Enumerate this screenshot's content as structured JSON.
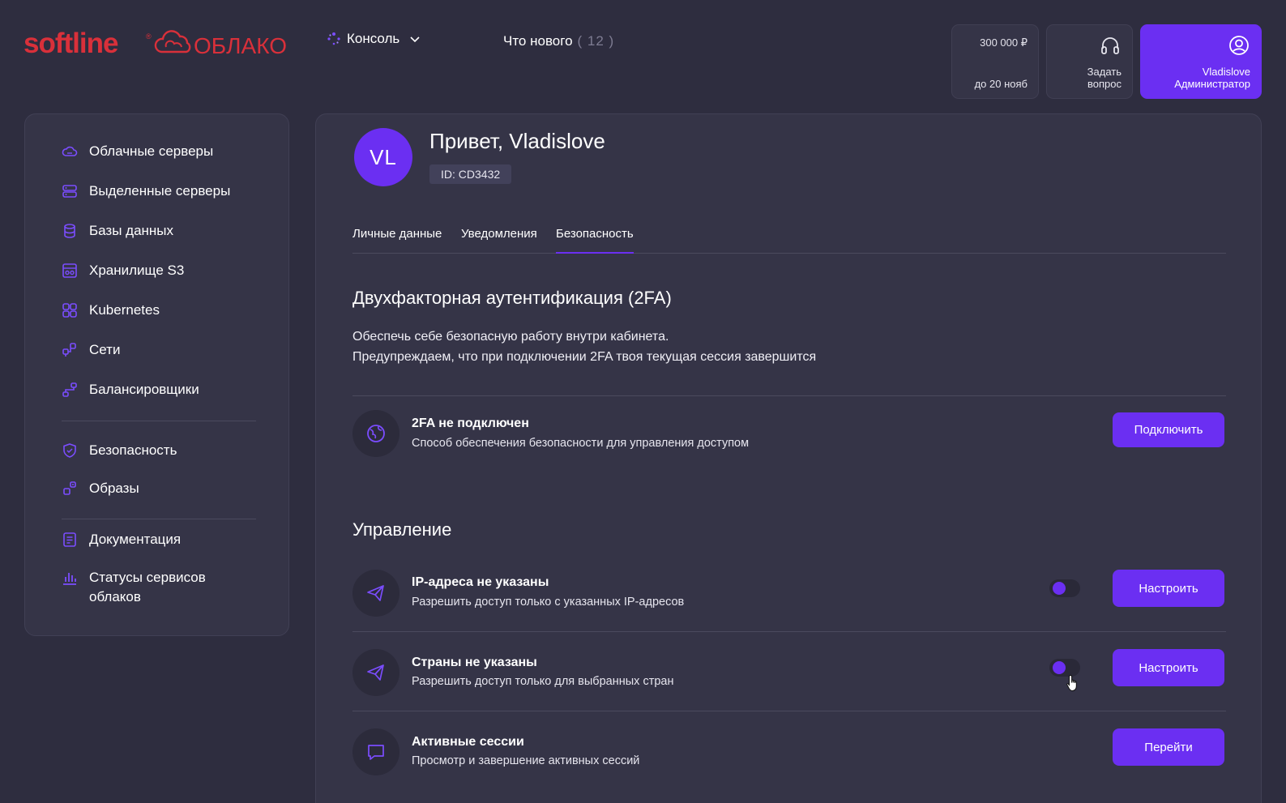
{
  "header": {
    "logo_text": "softline",
    "logo_suffix": "ОБЛАКО",
    "console_label": "Консоль",
    "whats_new_label": "Что нового",
    "whats_new_count": "( 12 )",
    "balance_amount": "300 000 ₽",
    "balance_due": "до 20 нояб",
    "support_label": "Задать вопрос",
    "user_name": "Vladislove",
    "user_role": "Администратор"
  },
  "sidebar": {
    "items": [
      {
        "label": "Облачные серверы",
        "icon": "cloud-icon"
      },
      {
        "label": "Выделенные серверы",
        "icon": "server-icon"
      },
      {
        "label": "Базы данных",
        "icon": "database-icon"
      },
      {
        "label": "Хранилище S3",
        "icon": "storage-icon"
      },
      {
        "label": "Kubernetes",
        "icon": "kubernetes-icon"
      },
      {
        "label": "Сети",
        "icon": "network-icon"
      },
      {
        "label": "Балансировщики",
        "icon": "balancer-icon"
      },
      {
        "label": "Безопасность",
        "icon": "shield-icon"
      },
      {
        "label": "Образы",
        "icon": "images-icon"
      },
      {
        "label": "Документация",
        "icon": "document-icon"
      },
      {
        "label": "Статусы сервисов облаков",
        "icon": "chart-icon"
      }
    ]
  },
  "profile": {
    "initials": "VL",
    "greeting": "Привет, Vladislove",
    "id_text": "ID: CD3432"
  },
  "tabs": [
    {
      "label": "Личные данные",
      "active": false
    },
    {
      "label": "Уведомления",
      "active": false
    },
    {
      "label": "Безопасность",
      "active": true
    }
  ],
  "twofa": {
    "heading": "Двухфакторная аутентификация (2FA)",
    "desc_line1": "Обеспечь себе безопасную работу внутри кабинета.",
    "desc_line2": "Предупреждаем, что при подключении 2FA твоя текущая сессия завершится",
    "status_title": "2FA не подключен",
    "status_sub": "Способ обеспечения безопасности для управления доступом",
    "button": "Подключить"
  },
  "management": {
    "heading": "Управление",
    "rows": [
      {
        "title": "IP-адреса не указаны",
        "sub": "Разрешить доступ только с указанных IP-адресов",
        "button": "Настроить",
        "toggle": false
      },
      {
        "title": "Страны не указаны",
        "sub": "Разрешить доступ только для выбранных стран",
        "button": "Настроить",
        "toggle": false
      },
      {
        "title": "Активные сессии",
        "sub": "Просмотр и завершение активных сессий",
        "button": "Перейти"
      }
    ]
  },
  "colors": {
    "accent": "#6b2ff2",
    "background": "#2e2d3f",
    "panel": "#353447",
    "logo_red": "#d9303a"
  }
}
